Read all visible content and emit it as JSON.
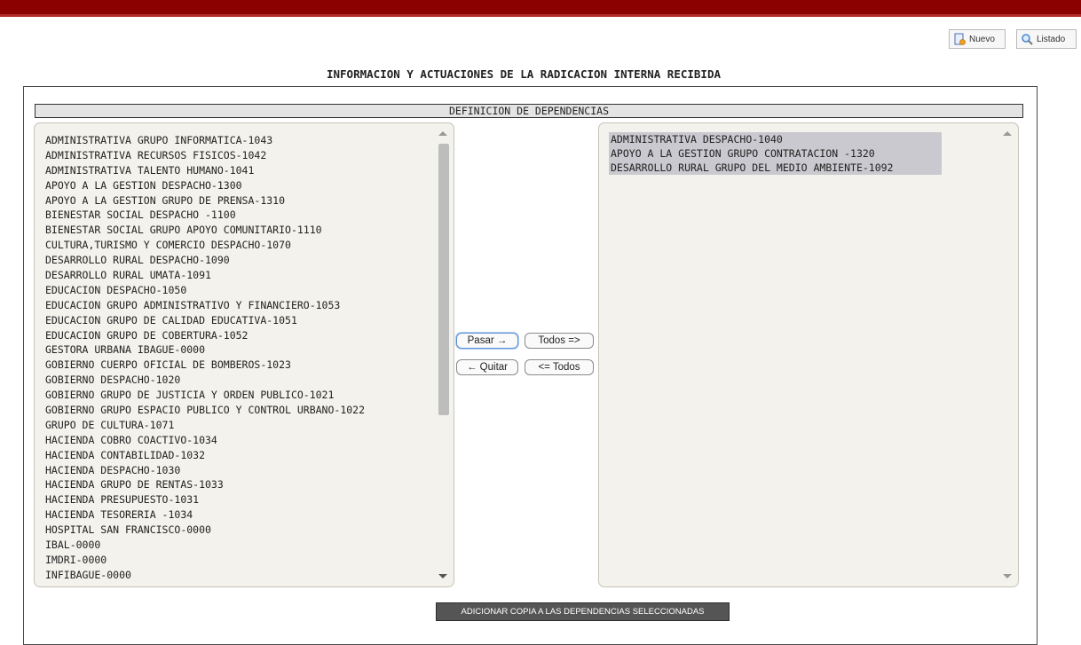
{
  "toolbar": {
    "nuevo_label": "Nuevo",
    "listado_label": "Listado"
  },
  "page_title": "INFORMACION Y ACTUACIONES DE LA RADICACION INTERNA RECIBIDA",
  "section_header": "DEFINICION DE DEPENDENCIAS",
  "available_list": [
    "ADMINISTRATIVA GRUPO INFORMATICA-1043",
    "ADMINISTRATIVA RECURSOS FISICOS-1042",
    "ADMINISTRATIVA TALENTO HUMANO-1041",
    "APOYO A LA GESTION DESPACHO-1300",
    "APOYO A LA GESTION GRUPO DE PRENSA-1310",
    "BIENESTAR SOCIAL DESPACHO -1100",
    "BIENESTAR SOCIAL GRUPO APOYO COMUNITARIO-1110",
    "CULTURA,TURISMO Y COMERCIO DESPACHO-1070",
    "DESARROLLO RURAL DESPACHO-1090",
    "DESARROLLO RURAL UMATA-1091",
    "EDUCACION DESPACHO-1050",
    "EDUCACION GRUPO ADMINISTRATIVO Y FINANCIERO-1053",
    "EDUCACION GRUPO DE CALIDAD EDUCATIVA-1051",
    "EDUCACION GRUPO DE COBERTURA-1052",
    "GESTORA URBANA IBAGUE-0000",
    "GOBIERNO CUERPO OFICIAL DE BOMBEROS-1023",
    "GOBIERNO DESPACHO-1020",
    "GOBIERNO GRUPO DE JUSTICIA Y ORDEN PUBLICO-1021",
    "GOBIERNO GRUPO ESPACIO PUBLICO Y CONTROL URBANO-1022",
    "GRUPO DE CULTURA-1071",
    "HACIENDA COBRO COACTIVO-1034",
    "HACIENDA CONTABILIDAD-1032",
    "HACIENDA DESPACHO-1030",
    "HACIENDA GRUPO DE RENTAS-1033",
    "HACIENDA PRESUPUESTO-1031",
    "HACIENDA TESORERIA -1034",
    "HOSPITAL SAN FRANCISCO-0000",
    "IBAL-0000",
    "IMDRI-0000",
    "INFIBAGUE-0000"
  ],
  "selected_list": [
    "ADMINISTRATIVA DESPACHO-1040",
    "APOYO A LA GESTION GRUPO CONTRATACION -1320",
    "DESARROLLO RURAL GRUPO DEL MEDIO AMBIENTE-1092"
  ],
  "buttons": {
    "pasar": "Pasar →",
    "todos_right": "Todos =>",
    "quitar": "← Quitar",
    "todos_left": "<= Todos",
    "adicionar": "ADICIONAR COPIA A LAS DEPENDENCIAS SELECCIONADAS"
  },
  "icons": {
    "nuevo": "new-document-icon",
    "listado": "magnifier-icon"
  },
  "colors": {
    "top_bar": "#8b0000",
    "selected_item_bg": "#c9c9cf",
    "submit_bg": "#555555"
  }
}
